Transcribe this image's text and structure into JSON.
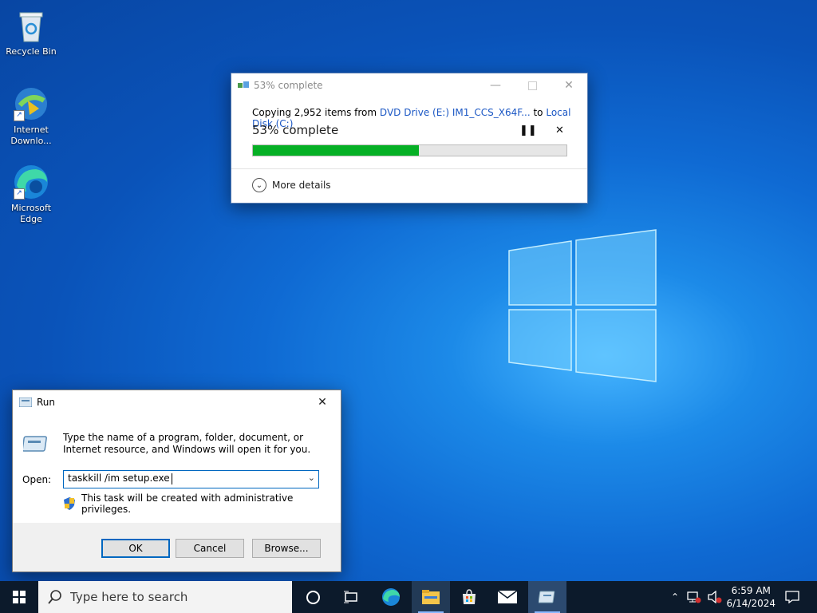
{
  "desktop": {
    "icons": [
      {
        "label": "Recycle Bin"
      },
      {
        "label": "Internet Downlo..."
      },
      {
        "label": "Microsoft Edge"
      }
    ]
  },
  "copy_dialog": {
    "title": "53% complete",
    "copy_prefix": "Copying 2,952 items from",
    "source": "DVD Drive (E:) IM1_CCS_X64F...",
    "to_word": "to",
    "destination": "Local Disk (C:)",
    "status": "53% complete",
    "progress_percent": 53,
    "more_details": "More details"
  },
  "run_dialog": {
    "title": "Run",
    "description": "Type the name of a program, folder, document, or Internet resource, and Windows will open it for you.",
    "open_label": "Open:",
    "open_value": "taskkill /im setup.exe",
    "admin_note": "This task will be created with administrative privileges.",
    "ok_label": "OK",
    "cancel_label": "Cancel",
    "browse_label": "Browse..."
  },
  "taskbar": {
    "search_placeholder": "Type here to search",
    "time": "6:59 AM",
    "date": "6/14/2024"
  },
  "colors": {
    "progress_fill": "#06b025",
    "link": "#1b57c4",
    "default_button_border": "#0067c0"
  }
}
